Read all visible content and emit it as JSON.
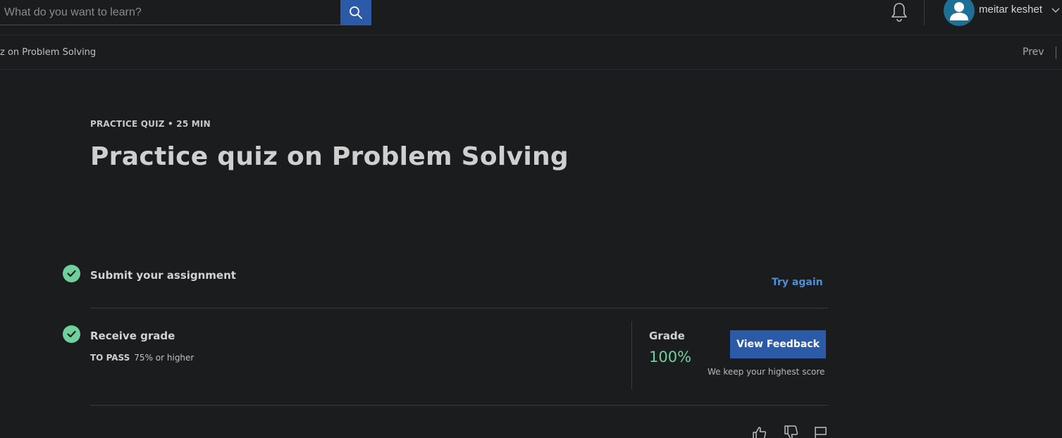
{
  "header": {
    "search_placeholder": "What do you want to learn?",
    "search_button_icon": "search-icon",
    "notification_icon": "bell-icon",
    "user_name": "meitar keshet"
  },
  "subnav": {
    "breadcrumb": "z on Problem Solving",
    "prev_label": "Prev"
  },
  "main": {
    "eyebrow": "PRACTICE QUIZ • 25 MIN",
    "title": "Practice quiz on Problem Solving",
    "steps": [
      {
        "label": "Submit your assignment",
        "action": "Try again"
      },
      {
        "label": "Receive grade",
        "to_pass_label": "TO PASS",
        "to_pass_value": "75% or higher"
      }
    ],
    "grade": {
      "label": "Grade",
      "value": "100%",
      "button": "View Feedback",
      "note": "We keep your highest score"
    }
  },
  "colors": {
    "background": "#1b1c1e",
    "accent_blue": "#2a5aa8",
    "link_blue": "#4f8fd8",
    "success_green": "#6fd09b"
  },
  "footer_icons": [
    "thumbs-up-icon",
    "thumbs-down-icon",
    "flag-icon"
  ]
}
